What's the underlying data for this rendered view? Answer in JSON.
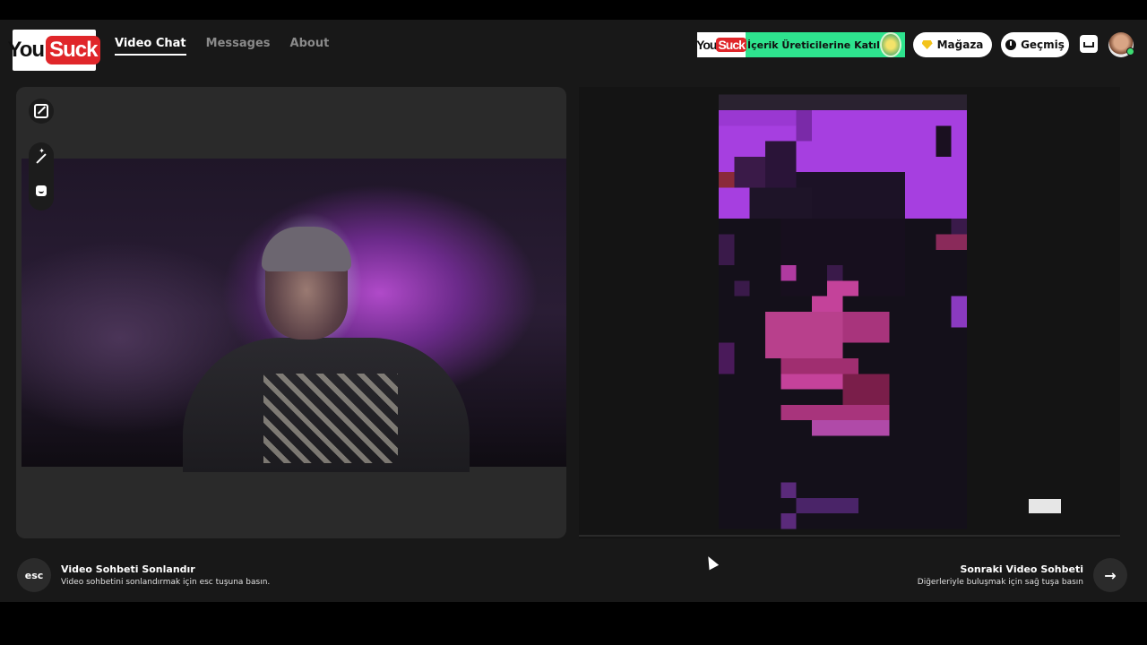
{
  "header": {
    "logo_you": "You",
    "logo_suck": "Suck",
    "nav": [
      {
        "label": "Video Chat",
        "active": true
      },
      {
        "label": "Messages",
        "active": false
      },
      {
        "label": "About",
        "active": false
      }
    ],
    "promo": {
      "logo_you": "You",
      "logo_suck": "Suck",
      "text": "İçerik Üreticilerine Katıl"
    },
    "store_label": "Mağaza",
    "history_label": "Geçmiş"
  },
  "local_tools": {
    "expand_icon": "expand-icon",
    "magic_icon": "magic-wand-icon",
    "emoji_icon": "emoji-icon"
  },
  "footer": {
    "esc_key": "esc",
    "end_title": "Video Sohbeti Sonlandır",
    "end_sub": "Video sohbetini sonlandırmak için esc tuşuna basın.",
    "next_title": "Sonraki Video Sohbeti",
    "next_sub": "Diğerleriyle buluşmak için sağ tuşa basın",
    "next_icon": "→"
  },
  "colors": {
    "app_bg": "#181818",
    "panel_bg": "#2a2a2a",
    "accent_red": "#e0262a",
    "promo_green": "#2ee38e",
    "pixel_purple": "#a63fe0",
    "pixel_pink": "#c4429a"
  }
}
